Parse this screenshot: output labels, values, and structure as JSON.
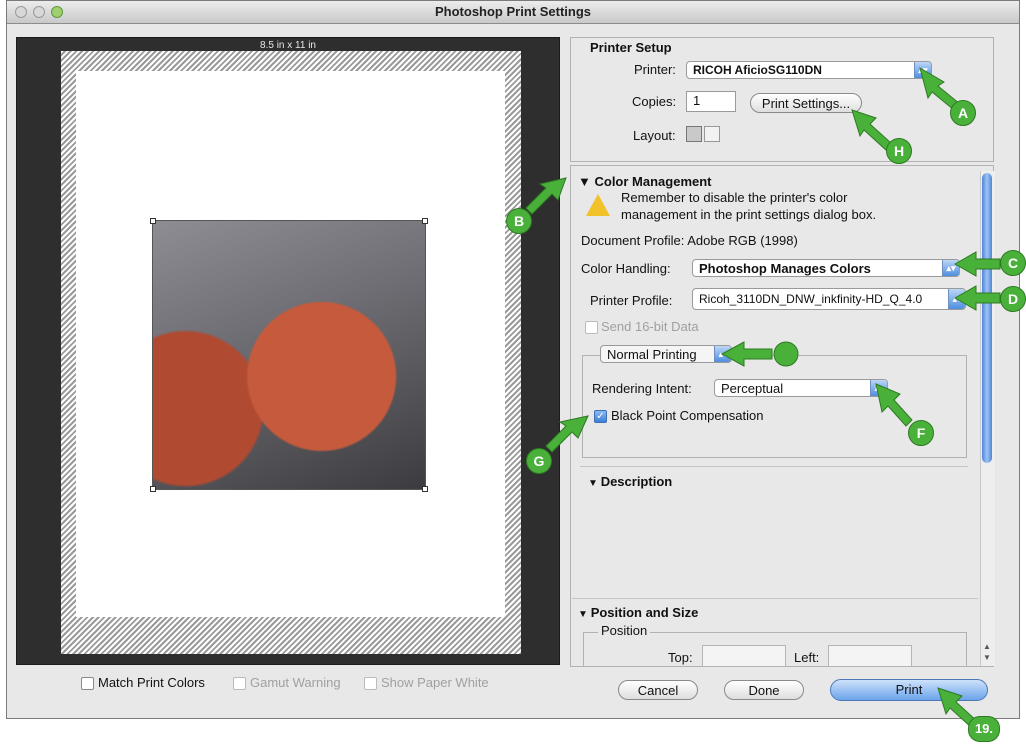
{
  "window": {
    "title": "Photoshop Print Settings"
  },
  "preview": {
    "paper_size": "8.5 in x 11 in"
  },
  "printer_setup": {
    "heading": "Printer Setup",
    "printer_label": "Printer:",
    "printer_value": "RICOH AficioSG110DN",
    "copies_label": "Copies:",
    "copies_value": "1",
    "print_settings_button": "Print Settings...",
    "layout_label": "Layout:"
  },
  "color_management": {
    "heading": "Color Management",
    "warning_line1": "Remember to disable the printer's color",
    "warning_line2": "management in the print settings dialog box.",
    "document_profile": "Document Profile: Adobe RGB (1998)",
    "color_handling_label": "Color Handling:",
    "color_handling_value": "Photoshop Manages Colors",
    "printer_profile_label": "Printer Profile:",
    "printer_profile_value": "Ricoh_3110DN_DNW_inkfinity-HD_Q_4.0",
    "send_16bit": "Send 16-bit Data",
    "mode_value": "Normal Printing",
    "rendering_intent_label": "Rendering Intent:",
    "rendering_intent_value": "Perceptual",
    "black_point": "Black Point Compensation"
  },
  "description": {
    "heading": "Description"
  },
  "position_size": {
    "heading": "Position and Size",
    "position_label": "Position",
    "top_label": "Top:",
    "left_label": "Left:"
  },
  "bottom_options": {
    "match_print_colors": "Match Print Colors",
    "gamut_warning": "Gamut Warning",
    "show_paper_white": "Show Paper White"
  },
  "buttons": {
    "cancel": "Cancel",
    "done": "Done",
    "print": "Print"
  },
  "callouts": {
    "a": "A",
    "b": "B",
    "c": "C",
    "d": "D",
    "f": "F",
    "g": "G",
    "h": "H",
    "step": "19."
  },
  "colors": {
    "callout_green": "#49b13a",
    "accent_blue": "#4f8ee0"
  },
  "icons": {
    "warning": "warning-icon",
    "layout_portrait": "portrait-icon",
    "layout_landscape": "landscape-icon"
  }
}
